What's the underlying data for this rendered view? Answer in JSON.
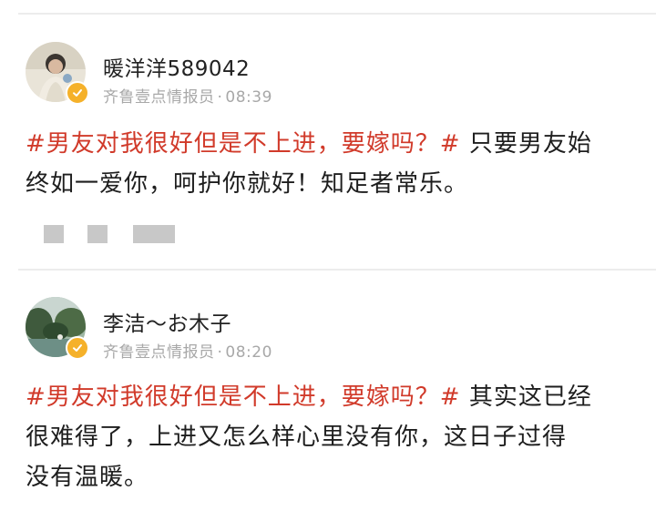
{
  "posts": [
    {
      "username": "暖洋洋589042",
      "source": "齐鲁壹点情报员",
      "separator": "·",
      "time": "08:39",
      "topic": "#男友对我很好但是不上进，要嫁吗？#",
      "body_line1": " 只要男友始",
      "body_line2": "终如一爱你，呵护你就好！知足者常乐。"
    },
    {
      "username": "李洁～お木子",
      "source": "齐鲁壹点情报员",
      "separator": "·",
      "time": "08:20",
      "topic": "#男友对我很好但是不上进，要嫁吗？#",
      "body_line1": " 其实这已经",
      "body_line2": "很难得了，上进又怎么样心里没有你，这日子过得",
      "body_line3": "没有温暖。"
    }
  ],
  "colors": {
    "topic": "#d13a2a",
    "meta": "#a8a8a8",
    "verified_badge": "#f5b12a",
    "placeholder_block": "#c8c8c8"
  },
  "icons": {
    "verified": "verified-badge-icon"
  }
}
